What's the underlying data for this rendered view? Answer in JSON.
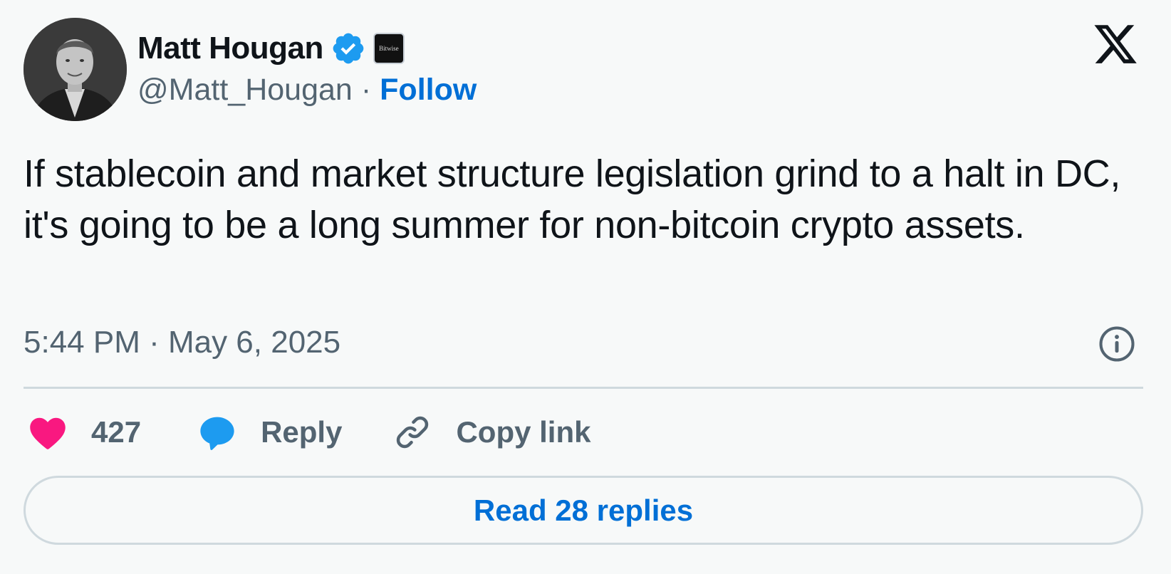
{
  "author": {
    "name": "Matt Hougan",
    "handle": "@Matt_Hougan",
    "separator": "·",
    "follow_label": "Follow",
    "affiliate_label": "Bitwise",
    "verified_icon": "verified-badge-icon",
    "avatar": "profile-photo"
  },
  "platform": {
    "logo_icon": "x-logo-icon"
  },
  "tweet": {
    "text": "If stablecoin and market structure legislation grind to a halt in DC, it's going to be a long summer for non-bitcoin crypto assets.",
    "timestamp": "5:44 PM · May 6, 2025",
    "info_icon": "info-icon"
  },
  "actions": {
    "like_count": "427",
    "reply_label": "Reply",
    "copy_link_label": "Copy link"
  },
  "replies_button": {
    "label": "Read 28 replies"
  },
  "colors": {
    "background": "#f7f9f9",
    "link_blue": "#006fd6",
    "verified_blue": "#1d9bf0",
    "like_pink": "#f91880",
    "muted_gray": "#536471",
    "border": "#cfd9de"
  }
}
